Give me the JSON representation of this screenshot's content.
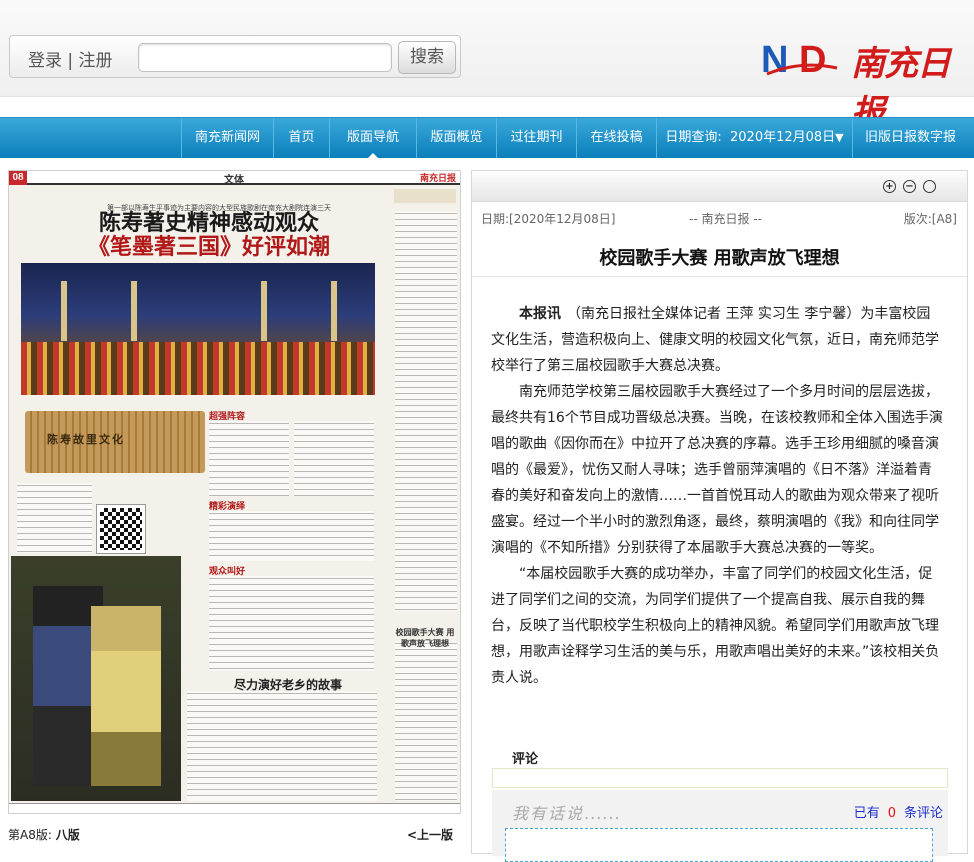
{
  "header": {
    "login_label": "登录 | 注册",
    "search_placeholder": "",
    "search_button": "搜索",
    "logo_text": "南充日报",
    "logo_mark": "ND"
  },
  "nav": {
    "items": [
      "南充新闻网",
      "首页",
      "版面导航",
      "版面概览",
      "过往期刊",
      "在线投稿"
    ],
    "date_label": "日期查询:",
    "date_value": "2020年12月08日",
    "old_edition": "旧版日报数字报",
    "active": "版面导航"
  },
  "newspaper": {
    "page_no": "08",
    "section": "文体",
    "brand": "南充日报",
    "lede": "第一部以陈寿生平事迹为主要内容的大型民族歌剧在南充大剧院连演三天",
    "headline_line1": "陈寿著史精神感动观众",
    "headline_line2": "《笔墨著三国》好评如潮",
    "scroll_text": "陈寿故里文化",
    "sub_a": "超强阵容",
    "sub_b": "精彩演绎",
    "sub_c": "观众叫好",
    "sub_feature": "尽力演好老乡的故事",
    "side_title": "校园歌手大赛 用歌声放飞理想"
  },
  "pager": {
    "edition_prefix": "第A8版:",
    "edition_name": "八版",
    "prev": "<上一版"
  },
  "article": {
    "toolbar_icons": [
      "zoom-in-icon",
      "zoom-out-icon",
      "reset-icon"
    ],
    "date": "日期:[2020年12月08日]",
    "source": "-- 南充日报 --",
    "page": "版次:[A8]",
    "title": "校园歌手大赛 用歌声放飞理想",
    "lead": "本报讯",
    "p1": "（南充日报社全媒体记者 王萍 实习生 李宁馨）为丰富校园文化生活，营造积极向上、健康文明的校园文化气氛，近日，南充师范学校举行了第三届校园歌手大赛总决赛。",
    "p2": "南充师范学校第三届校园歌手大赛经过了一个多月时间的层层选拔，最终共有16个节目成功晋级总决赛。当晚，在该校教师和全体入围选手演唱的歌曲《因你而在》中拉开了总决赛的序幕。选手王珍用细腻的嗓音演唱的《最爱》，忧伤又耐人寻味；选手曾丽萍演唱的《日不落》洋溢着青春的美好和奋发向上的激情……一首首悦耳动人的歌曲为观众带来了视听盛宴。经过一个半小时的激烈角逐，最终，蔡明演唱的《我》和向往同学演唱的《不知所措》分别获得了本届歌手大赛总决赛的一等奖。",
    "p3": "“本届校园歌手大赛的成功举办，丰富了同学们的校园文化生活，促进了同学们之间的交流，为同学们提供了一个提高自我、展示自我的舞台，反映了当代职校学生积极向上的精神风貌。希望同学们用歌声放飞理想，用歌声诠释学习生活的美与乐，用歌声唱出美好的未来。”该校相关负责人说。"
  },
  "comments": {
    "label": "评论",
    "placeholder": "我有话说",
    "placeholder_dots": "......",
    "count_prefix": "已有",
    "count": "0",
    "count_suffix": "条评论"
  },
  "colors": {
    "nav_blue": "#1b8fc8",
    "brand_red": "#d21c1c",
    "link_blue": "#1d2fcf"
  }
}
